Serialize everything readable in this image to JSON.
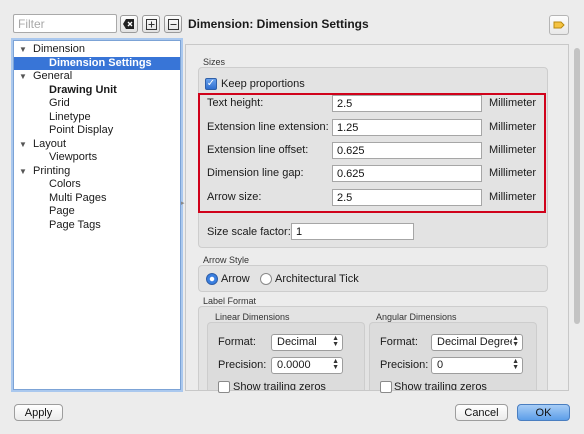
{
  "filter": {
    "placeholder": "Filter"
  },
  "toolbar": {
    "clear_icon": "backspace-icon",
    "expand_icon": "expand-all-icon",
    "collapse_icon": "collapse-all-icon"
  },
  "page_title": "Dimension: Dimension Settings",
  "tree": {
    "items": [
      {
        "label": "Dimension",
        "level": 0,
        "expanded": true
      },
      {
        "label": "Dimension Settings",
        "level": 1,
        "selected": true
      },
      {
        "label": "General",
        "level": 0,
        "expanded": true
      },
      {
        "label": "Drawing Unit",
        "level": 1,
        "bold": true
      },
      {
        "label": "Grid",
        "level": 1
      },
      {
        "label": "Linetype",
        "level": 1
      },
      {
        "label": "Point Display",
        "level": 1
      },
      {
        "label": "Layout",
        "level": 0,
        "expanded": true
      },
      {
        "label": "Viewports",
        "level": 1
      },
      {
        "label": "Printing",
        "level": 0,
        "expanded": true
      },
      {
        "label": "Colors",
        "level": 1
      },
      {
        "label": "Multi Pages",
        "level": 1
      },
      {
        "label": "Page",
        "level": 1
      },
      {
        "label": "Page Tags",
        "level": 1
      }
    ]
  },
  "sizes": {
    "section_label": "Sizes",
    "keep_proportions": {
      "label": "Keep proportions",
      "checked": true
    },
    "rows": [
      {
        "label": "Text height:",
        "value": "2.5",
        "unit": "Millimeter"
      },
      {
        "label": "Extension line extension:",
        "value": "1.25",
        "unit": "Millimeter"
      },
      {
        "label": "Extension line offset:",
        "value": "0.625",
        "unit": "Millimeter"
      },
      {
        "label": "Dimension line gap:",
        "value": "0.625",
        "unit": "Millimeter"
      },
      {
        "label": "Arrow size:",
        "value": "2.5",
        "unit": "Millimeter"
      }
    ],
    "scale": {
      "label": "Size scale factor:",
      "value": "1"
    }
  },
  "arrow_style": {
    "section_label": "Arrow Style",
    "options": [
      {
        "label": "Arrow",
        "checked": true
      },
      {
        "label": "Architectural Tick",
        "checked": false
      }
    ]
  },
  "label_format": {
    "section_label": "Label Format",
    "linear": {
      "title": "Linear Dimensions",
      "format_label": "Format:",
      "format_value": "Decimal",
      "precision_label": "Precision:",
      "precision_value": "0.0000",
      "trailing_label": "Show trailing zeros"
    },
    "angular": {
      "title": "Angular Dimensions",
      "format_label": "Format:",
      "format_value": "Decimal Degree",
      "precision_label": "Precision:",
      "precision_value": "0",
      "trailing_label": "Show trailing zeros"
    }
  },
  "buttons": {
    "apply": "Apply",
    "cancel": "Cancel",
    "ok": "OK"
  },
  "colors": {
    "selection": "#3875d7",
    "highlight_box": "#d0021b",
    "default_button": "#5d9ee9"
  }
}
